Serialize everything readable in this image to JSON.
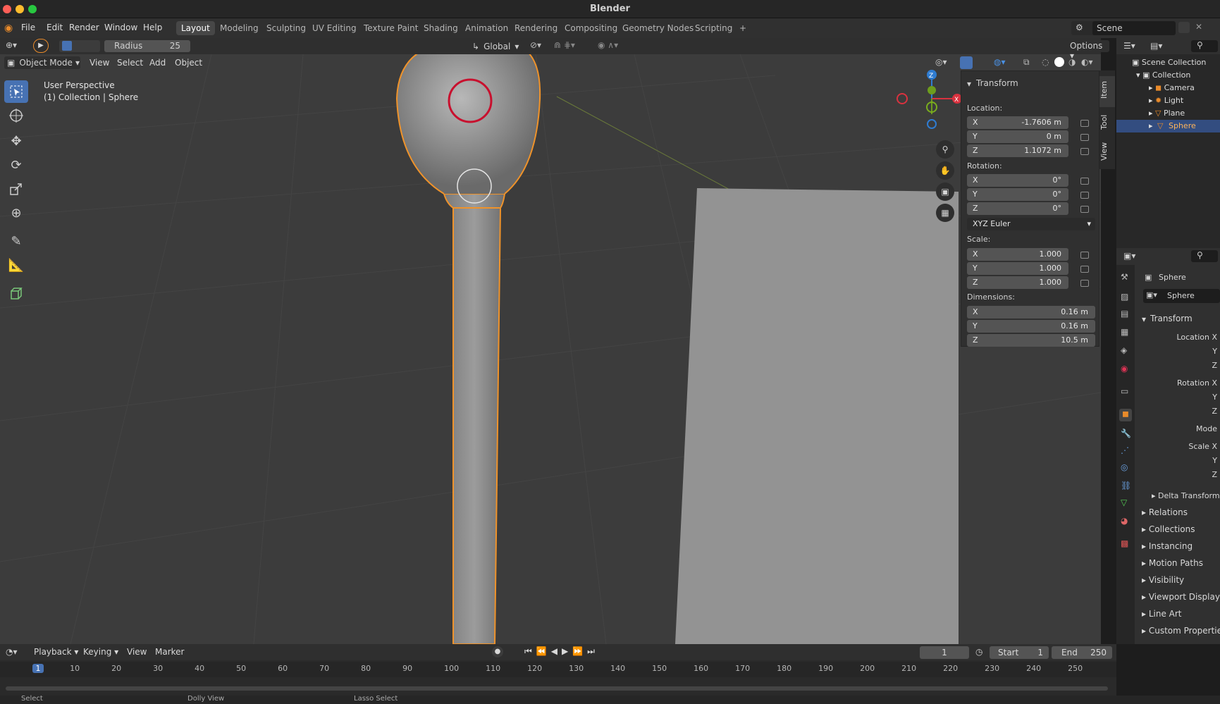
{
  "window": {
    "title": "Blender"
  },
  "menu": {
    "items": [
      "File",
      "Edit",
      "Render",
      "Window",
      "Help"
    ],
    "workspaces": [
      "Layout",
      "Modeling",
      "Sculpting",
      "UV Editing",
      "Texture Paint",
      "Shading",
      "Animation",
      "Rendering",
      "Compositing",
      "Geometry Nodes",
      "Scripting"
    ],
    "active_workspace": "Layout",
    "add_tab": "+",
    "scene": "Scene"
  },
  "tool_header": {
    "radius_label": "Radius",
    "radius_value": "25",
    "orientation": "Global",
    "options": "Options"
  },
  "viewport_header": {
    "mode": "Object Mode",
    "menus": [
      "View",
      "Select",
      "Add",
      "Object"
    ]
  },
  "viewport": {
    "perspective": "User Perspective",
    "collection": "(1) Collection | Sphere"
  },
  "sidebar_tabs": [
    "Item",
    "Tool",
    "View"
  ],
  "transform": {
    "title": "Transform",
    "location_label": "Location:",
    "location": [
      {
        "axis": "X",
        "value": "-1.7606 m"
      },
      {
        "axis": "Y",
        "value": "0 m"
      },
      {
        "axis": "Z",
        "value": "1.1072 m"
      }
    ],
    "rotation_label": "Rotation:",
    "rotation": [
      {
        "axis": "X",
        "value": "0°"
      },
      {
        "axis": "Y",
        "value": "0°"
      },
      {
        "axis": "Z",
        "value": "0°"
      }
    ],
    "rotation_mode": "XYZ Euler",
    "scale_label": "Scale:",
    "scale": [
      {
        "axis": "X",
        "value": "1.000"
      },
      {
        "axis": "Y",
        "value": "1.000"
      },
      {
        "axis": "Z",
        "value": "1.000"
      }
    ],
    "dimensions_label": "Dimensions:",
    "dimensions": [
      {
        "axis": "X",
        "value": "0.16 m"
      },
      {
        "axis": "Y",
        "value": "0.16 m"
      },
      {
        "axis": "Z",
        "value": "10.5 m"
      }
    ]
  },
  "outliner": {
    "scene_collection": "Scene Collection",
    "collection": "Collection",
    "items": [
      "Camera",
      "Light",
      "Plane",
      "Sphere"
    ],
    "selected": "Sphere"
  },
  "properties": {
    "object_name": "Sphere",
    "data_name": "Sphere",
    "transform_title": "Transform",
    "labels": [
      "Location X",
      "Y",
      "Z",
      "Rotation X",
      "Y",
      "Z",
      "Mode",
      "Scale X",
      "Y",
      "Z"
    ],
    "delta": "Delta Transform",
    "sections": [
      "Relations",
      "Collections",
      "Instancing",
      "Motion Paths",
      "Visibility",
      "Viewport Display",
      "Line Art",
      "Custom Properties"
    ]
  },
  "timeline": {
    "menus": [
      "Playback",
      "Keying",
      "View",
      "Marker"
    ],
    "current_frame": "1",
    "start_label": "Start",
    "start": "1",
    "end_label": "End",
    "end": "250",
    "ticks": [
      "1",
      "10",
      "20",
      "30",
      "40",
      "50",
      "60",
      "70",
      "80",
      "90",
      "100",
      "110",
      "120",
      "130",
      "140",
      "150",
      "160",
      "170",
      "180",
      "190",
      "200",
      "210",
      "220",
      "230",
      "240",
      "250"
    ]
  },
  "statusbar": {
    "items": [
      "Select",
      "Dolly View",
      "Lasso Select"
    ]
  },
  "colors": {
    "selection": "#f0932a",
    "accent": "#4772b3",
    "background": "#3c3c3c"
  }
}
